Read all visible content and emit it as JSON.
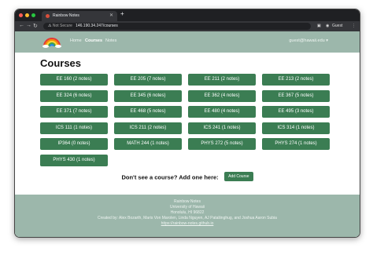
{
  "browser": {
    "tab_title": "Rainbow Notes",
    "security_label": "Not Secure",
    "url": "146.190.34.247/courses",
    "profile_label": "Guest"
  },
  "navbar": {
    "links": [
      "Home",
      "Courses",
      "Notes"
    ],
    "user_label": "guest@hawaii.edu ▾"
  },
  "page": {
    "title": "Courses",
    "courses": [
      "EE 160 (2 notes)",
      "EE 205 (7 notes)",
      "EE 211 (2 notes)",
      "EE 213 (2 notes)",
      "EE 324 (6 notes)",
      "EE 345 (6 notes)",
      "EE 362 (4 notes)",
      "EE 367 (5 notes)",
      "EE 371 (7 notes)",
      "EE 468 (5 notes)",
      "EE 480 (4 notes)",
      "EE 495 (3 notes)",
      "ICS 111 (1 notes)",
      "ICS 211 (2 notes)",
      "ICS 241 (1 notes)",
      "ICS 314 (1 notes)",
      "IP364 (0 notes)",
      "MATH 244 (1 notes)",
      "PHYS 272 (5 notes)",
      "PHYS 274 (1 notes)",
      "PHYS 430 (1 notes)"
    ],
    "cta_text": "Don't see a course? Add one here:",
    "add_button": "Add Course"
  },
  "footer": {
    "lines": [
      "Rainbow Notes",
      "University of Hawaii",
      "Honolulu, HI 96822",
      "Created by: Alex Bozarth, Maris Von Marolen, Linda Nguyen, AJ Pataliinghug, and Joshua Aaron Subia"
    ],
    "link": "https://rainbow-notes.github.io"
  },
  "colors": {
    "navbar_bg": "#9cb7ab",
    "button_bg": "#3b7d53"
  }
}
